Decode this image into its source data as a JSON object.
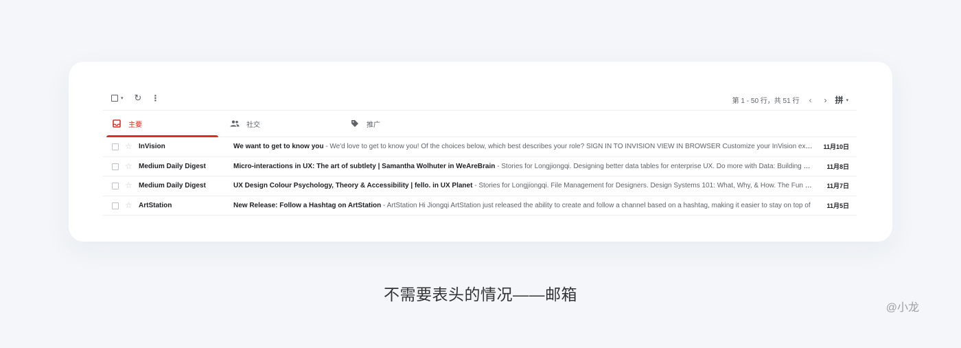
{
  "toolbar": {
    "checkbox_icon": "checkbox-square-icon",
    "select_caret": "▾",
    "refresh_glyph": "↻",
    "more_glyph": "⋮",
    "pagination": "第 1 - 50 行，共 51 行",
    "prev_glyph": "‹",
    "next_glyph": "›",
    "ime_label": "拼",
    "ime_caret": "▾"
  },
  "tabs": [
    {
      "label": "主要",
      "icon": "inbox-icon",
      "active": true
    },
    {
      "label": "社交",
      "icon": "people-icon",
      "active": false
    },
    {
      "label": "推广",
      "icon": "tag-icon",
      "active": false
    }
  ],
  "emails": [
    {
      "sender": "InVision",
      "subject": "We want to get to know you",
      "snippet": " - We'd love to get to know you! Of the choices below, which best describes your role? SIGN IN TO INVISION VIEW IN BROWSER Customize your InVision experience",
      "date": "11月10日"
    },
    {
      "sender": "Medium Daily Digest",
      "subject": "Micro-interactions in UX: The art of subtlety | Samantha Wolhuter in WeAreBrain",
      "snippet": " - Stories for Longjiongqi. Designing better data tables for enterprise UX. Do more with Data: Building a Data",
      "date": "11月8日"
    },
    {
      "sender": "Medium Daily Digest",
      "subject": "UX Design Colour Psychology, Theory & Accessibility | fello. in UX Planet",
      "snippet": " - Stories for Longjiongqi. File Management for Designers. Design Systems 101: What, Why, & How. The Fun of the",
      "date": "11月7日"
    },
    {
      "sender": "ArtStation",
      "subject": "New Release: Follow a Hashtag on ArtStation",
      "snippet": " - ArtStation Hi Jiongqi ArtStation just released the ability to create and follow a channel based on a hashtag, making it easier to stay on top of",
      "date": "11月5日"
    }
  ],
  "row_icons": {
    "checkbox": "checkbox-icon",
    "star_glyph": "☆"
  },
  "colors": {
    "accent": "#d93025",
    "background": "#f4f6f9",
    "card": "#ffffff"
  },
  "caption": "不需要表头的情况——邮箱",
  "watermark": "@小龙"
}
